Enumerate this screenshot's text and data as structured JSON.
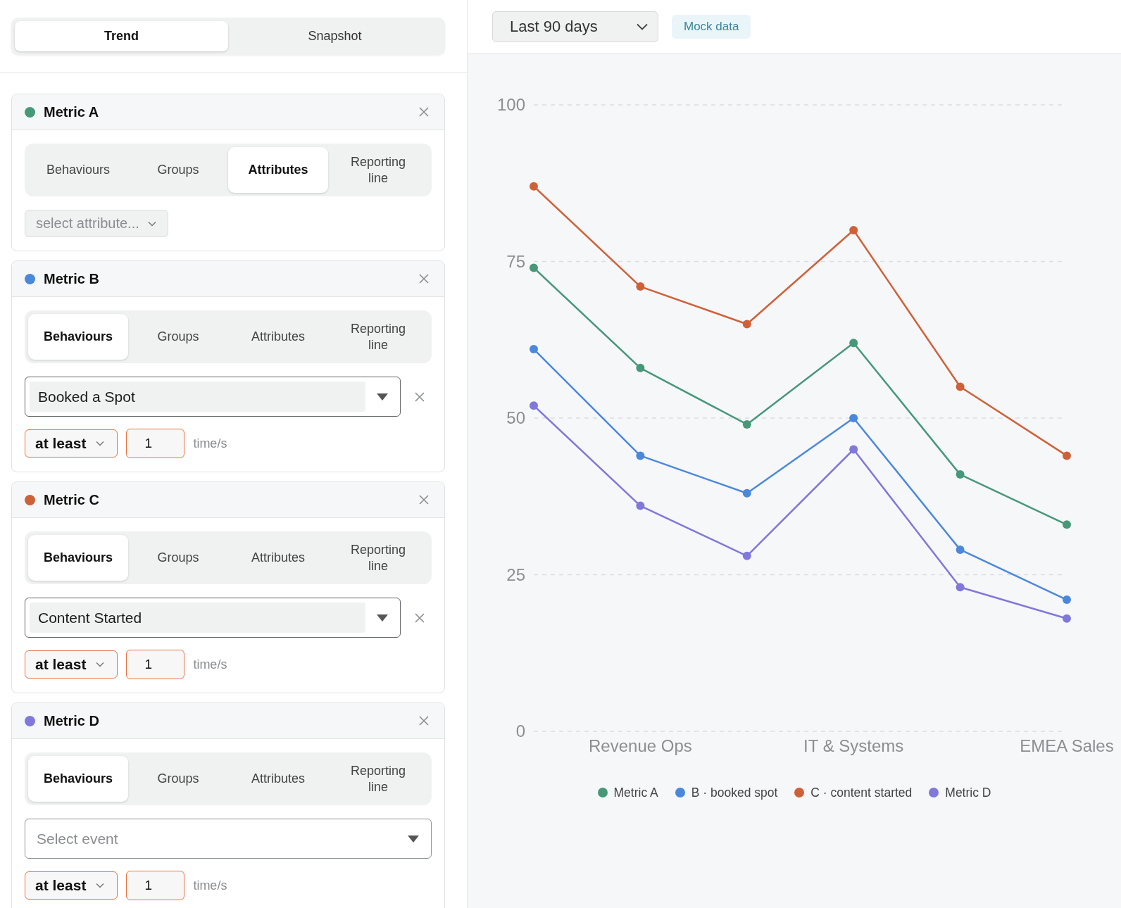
{
  "mode_tabs": [
    {
      "label": "Trend",
      "selected": true
    },
    {
      "label": "Snapshot",
      "selected": false
    }
  ],
  "metrics": [
    {
      "name": "Metric A",
      "color": "#479879",
      "kind": "attributes",
      "tabs": [
        {
          "label": "Behaviours",
          "selected": false
        },
        {
          "label": "Groups",
          "selected": false
        },
        {
          "label": "Attributes",
          "selected": true
        },
        {
          "label": "Reporting line",
          "selected": false
        }
      ],
      "attribute_select": {
        "placeholder": "select attribute..."
      }
    },
    {
      "name": "Metric B",
      "color": "#4b88dc",
      "kind": "behaviours",
      "tabs": [
        {
          "label": "Behaviours",
          "selected": true
        },
        {
          "label": "Groups",
          "selected": false
        },
        {
          "label": "Attributes",
          "selected": false
        },
        {
          "label": "Reporting line",
          "selected": false
        }
      ],
      "event_select": {
        "value": "Booked a Spot"
      },
      "frequency": {
        "operator": "at least",
        "count": "1",
        "unit": "time/s"
      }
    },
    {
      "name": "Metric C",
      "color": "#cf6139",
      "kind": "behaviours",
      "tabs": [
        {
          "label": "Behaviours",
          "selected": true
        },
        {
          "label": "Groups",
          "selected": false
        },
        {
          "label": "Attributes",
          "selected": false
        },
        {
          "label": "Reporting line",
          "selected": false
        }
      ],
      "event_select": {
        "value": "Content Started"
      },
      "frequency": {
        "operator": "at least",
        "count": "1",
        "unit": "time/s"
      }
    },
    {
      "name": "Metric D",
      "color": "#8078db",
      "kind": "behaviours",
      "tabs": [
        {
          "label": "Behaviours",
          "selected": true
        },
        {
          "label": "Groups",
          "selected": false
        },
        {
          "label": "Attributes",
          "selected": false
        },
        {
          "label": "Reporting line",
          "selected": false
        }
      ],
      "event_select": {
        "placeholder": "Select event"
      },
      "frequency": {
        "operator": "at least",
        "count": "1",
        "unit": "time/s"
      }
    }
  ],
  "chart_panel": {
    "date_range": {
      "value": "Last 90 days"
    },
    "badge": "Mock data",
    "chart_data": {
      "type": "line",
      "categories": [
        null,
        "Revenue Ops",
        null,
        "IT & Systems",
        null,
        "EMEA Sales"
      ],
      "ylim": [
        0,
        100
      ],
      "yticks": [
        0,
        25,
        50,
        75,
        100
      ],
      "grid": true,
      "series": [
        {
          "name": "Metric A",
          "color": "#479879",
          "marker": "circle",
          "values": [
            74,
            58,
            49,
            62,
            41,
            33
          ]
        },
        {
          "name": "B · booked spot",
          "color": "#4b88dc",
          "marker": "circle",
          "values": [
            61,
            44,
            38,
            50,
            29,
            21
          ]
        },
        {
          "name": "C · content started",
          "color": "#cf6139",
          "marker": "circle",
          "values": [
            87,
            71,
            65,
            80,
            55,
            44
          ]
        },
        {
          "name": "Metric D",
          "color": "#8078db",
          "marker": "circle",
          "values": [
            52,
            36,
            28,
            45,
            23,
            18
          ]
        }
      ]
    }
  }
}
